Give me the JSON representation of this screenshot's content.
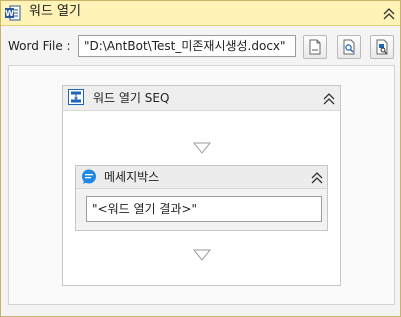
{
  "activity": {
    "title": "워드 열기",
    "icon": "word-icon"
  },
  "word_file": {
    "label": "Word File :",
    "value": "\"D:\\AntBot\\Test_미존재시생성.docx\""
  },
  "toolbar": {
    "buttons": [
      "browse-file-icon",
      "preview-icon",
      "expression-icon"
    ]
  },
  "sequence": {
    "title": "워드 열기 SEQ",
    "icon": "sequence-icon"
  },
  "messagebox": {
    "title": "메세지박스",
    "icon": "message-bubble-icon",
    "value": "\"<워드 열기 결과>\""
  },
  "colors": {
    "header_yellow": "#fff3b8",
    "word_blue": "#2b579a",
    "message_blue": "#1e88e5"
  }
}
